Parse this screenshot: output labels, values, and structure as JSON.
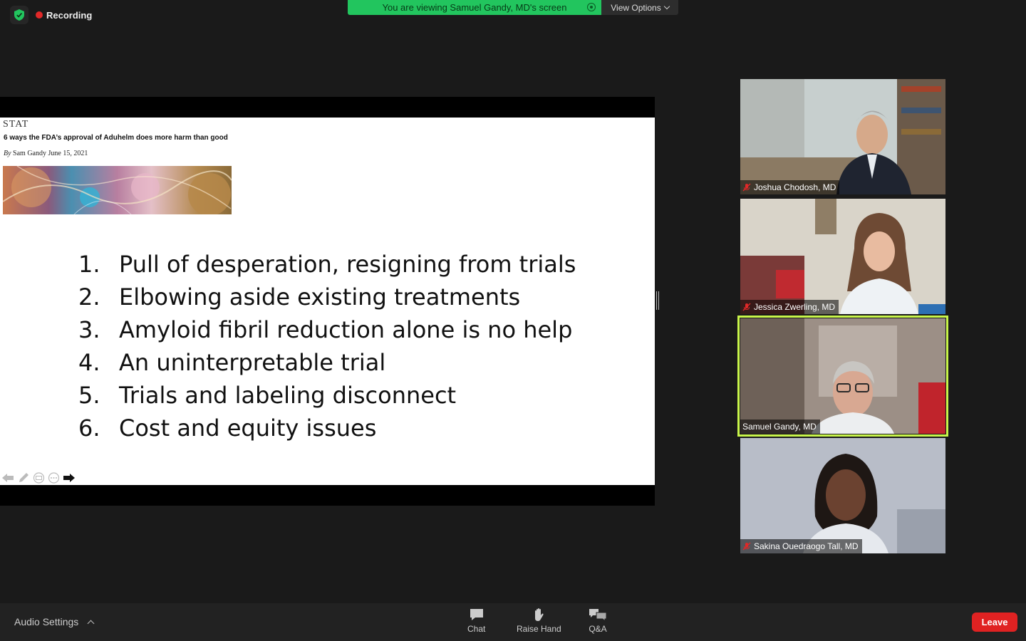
{
  "top_bar": {
    "recording_label": "Recording",
    "viewing_banner": "You are viewing Samuel Gandy, MD's screen",
    "view_options_label": "View Options"
  },
  "slide": {
    "logo": "STAT",
    "headline": "6 ways the FDA’s approval of Aduhelm does more harm than good",
    "byline_prefix": "By",
    "byline_text": "Sam Gandy June 15, 2021",
    "points": [
      {
        "num": "1.",
        "text": "Pull of desperation, resigning from trials"
      },
      {
        "num": "2.",
        "text": "Elbowing aside existing treatments"
      },
      {
        "num": "3.",
        "text": "Amyloid fibril reduction alone is no help"
      },
      {
        "num": "4.",
        "text": "An uninterpretable trial"
      },
      {
        "num": "5.",
        "text": "Trials and labeling disconnect"
      },
      {
        "num": "6.",
        "text": "Cost and equity issues"
      }
    ]
  },
  "participants": [
    {
      "name": "Joshua Chodosh, MD",
      "muted": true,
      "active": false
    },
    {
      "name": "Jessica Zwerling, MD",
      "muted": true,
      "active": false
    },
    {
      "name": "Samuel Gandy, MD",
      "muted": false,
      "active": true
    },
    {
      "name": "Sakina Ouedraogo Tall, MD",
      "muted": true,
      "active": false
    }
  ],
  "bottom_bar": {
    "audio_settings_label": "Audio Settings",
    "chat_label": "Chat",
    "raise_hand_label": "Raise Hand",
    "qa_label": "Q&A",
    "leave_label": "Leave"
  },
  "colors": {
    "banner_green": "#22c55e",
    "active_speaker": "#c8f54a",
    "leave_red": "#e02222",
    "mute_red": "#e02828"
  }
}
